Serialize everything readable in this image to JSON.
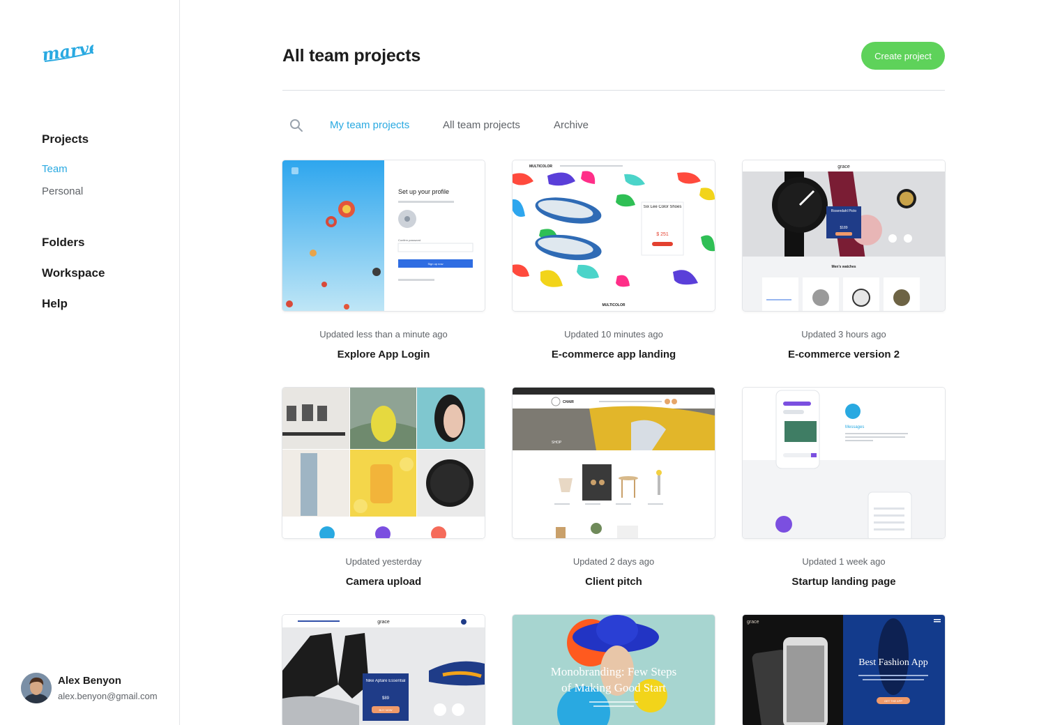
{
  "brand": {
    "logo_text": "marvel",
    "accent": "#29a9e1",
    "cta_color": "#5ed25a"
  },
  "sidebar": {
    "sections": [
      {
        "label": "Projects"
      },
      {
        "label": "Folders"
      },
      {
        "label": "Workspace"
      },
      {
        "label": "Help"
      }
    ],
    "project_items": [
      {
        "label": "Team",
        "active": true
      },
      {
        "label": "Personal",
        "active": false
      }
    ],
    "user": {
      "name": "Alex Benyon",
      "email": "alex.benyon@gmail.com"
    }
  },
  "main": {
    "title": "All team projects",
    "create_label": "Create project",
    "search_icon": "search-icon",
    "tabs": [
      {
        "label": "My team projects",
        "active": true
      },
      {
        "label": "All team projects",
        "active": false
      },
      {
        "label": "Archive",
        "active": false
      }
    ],
    "projects": [
      {
        "updated": "Updated less than a minute ago",
        "title": "Explore App Login",
        "thumb": {
          "heading": "Set up your profile",
          "field_label": "Confirm password",
          "button": "Sign up now"
        }
      },
      {
        "updated": "Updated 10 minutes ago",
        "title": "E-commerce app landing",
        "thumb": {
          "brand": "MULTICOLOR",
          "product": "Six Lee Color Shoes",
          "price": "$ 251"
        }
      },
      {
        "updated": "Updated 3 hours ago",
        "title": "E-commerce version 2",
        "thumb": {
          "brand": "grace",
          "product": "Rosendahl Picto",
          "price": "$189",
          "section": "Men's watches"
        }
      },
      {
        "updated": "Updated yesterday",
        "title": "Camera upload",
        "thumb": {}
      },
      {
        "updated": "Updated 2 days ago",
        "title": "Client pitch",
        "thumb": {
          "brand": "CHAIR",
          "banner": "SHOP"
        }
      },
      {
        "updated": "Updated 1 week ago",
        "title": "Startup landing page",
        "thumb": {
          "label": "Messages"
        }
      },
      {
        "updated": "",
        "title": "",
        "thumb": {
          "brand": "grace",
          "product": "Nike Aptare Essential",
          "price": "$89",
          "button": "BUY NOW"
        }
      },
      {
        "updated": "",
        "title": "",
        "thumb": {
          "line1": "Monobranding: Few Steps",
          "line2": "of Making Good Start"
        }
      },
      {
        "updated": "",
        "title": "",
        "thumb": {
          "brand": "grace",
          "headline": "Best Fashion App",
          "button": "GET THE APP"
        }
      }
    ]
  }
}
